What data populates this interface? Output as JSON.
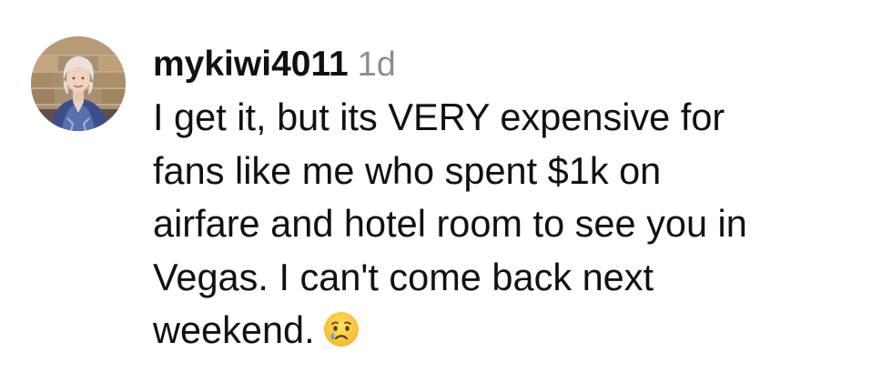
{
  "comment": {
    "avatar_icon": "user-avatar-photo",
    "username": "mykiwi4011",
    "timestamp": "1d",
    "text_lines": [
      "I get it, but its VERY expensive for",
      "fans like me who spent $1k on",
      "airfare and hotel room to see you in",
      "Vegas. I can't come back next",
      "weekend."
    ],
    "emoji_icon": "crying-face-emoji",
    "colors": {
      "text": "#111111",
      "timestamp": "#8e8e8e",
      "background": "#ffffff"
    }
  }
}
